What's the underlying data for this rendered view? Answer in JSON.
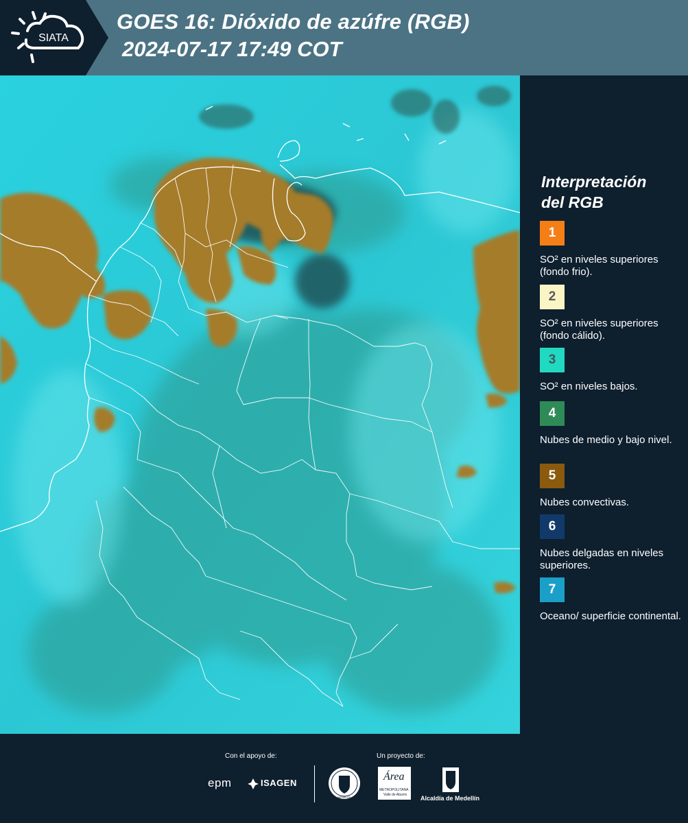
{
  "header": {
    "logo_text": "SIATA",
    "title": "GOES 16: Dióxido de azúfre (RGB)",
    "datetime": "2024-07-17 17:49 COT"
  },
  "legend": {
    "title_line1": "Interpretación",
    "title_line2": "del RGB",
    "items": [
      {
        "number": "1",
        "color": "#f57f17",
        "number_color": "#ffffff",
        "text": "SO² en niveles superiores (fondo frio)."
      },
      {
        "number": "2",
        "color": "#fbf5c6",
        "number_color": "#5a5a5a",
        "text": "SO² en niveles superiores (fondo cálido)."
      },
      {
        "number": "3",
        "color": "#21d9c1",
        "number_color": "#3c5a5a",
        "text": "SO² en niveles bajos."
      },
      {
        "number": "4",
        "color": "#2e8b57",
        "number_color": "#ffffff",
        "text": "Nubes de medio y bajo nivel."
      },
      {
        "number": "5",
        "color": "#8b5a0e",
        "number_color": "#ffffff",
        "text": "Nubes convectivas."
      },
      {
        "number": "6",
        "color": "#113a6b",
        "number_color": "#ffffff",
        "text": "Nubes delgadas en niveles superiores."
      },
      {
        "number": "7",
        "color": "#1aa0c8",
        "number_color": "#ffffff",
        "text": "Oceano/ superficie continental."
      }
    ]
  },
  "footer": {
    "support_label": "Con el apoyo de:",
    "project_label": "Un proyecto de:",
    "epm": "epm",
    "isagen": "ISAGEN",
    "area_script": "Área",
    "area_sub1": "METROPOLITANA",
    "area_sub2": "Valle de Aburrá",
    "alcaldia": "Alcaldía de Medellín",
    "seal_text": "MEDELLÍN"
  }
}
